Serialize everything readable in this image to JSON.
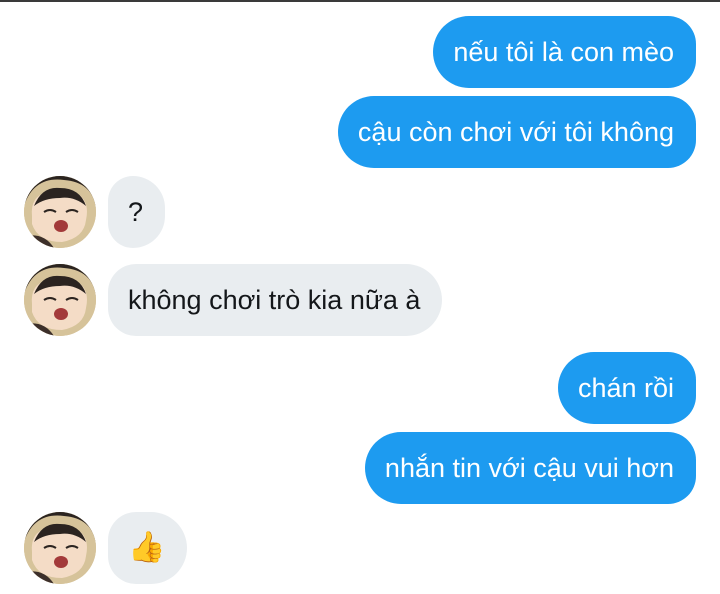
{
  "conversation": {
    "messages": [
      {
        "from": "me",
        "text": "nếu tôi là con mèo"
      },
      {
        "from": "me",
        "text": "cậu còn chơi với tôi không"
      },
      {
        "from": "other",
        "text": "?"
      },
      {
        "from": "other",
        "text": "không chơi trò kia nữa à"
      },
      {
        "from": "me",
        "text": "chán rồi"
      },
      {
        "from": "me",
        "text": "nhắn tin với cậu vui hơn"
      },
      {
        "from": "other",
        "text": "👍"
      }
    ]
  },
  "colors": {
    "outgoing_bubble": "#1d9bf0",
    "incoming_bubble": "#e9edf0",
    "incoming_text": "#14171a"
  },
  "icons": {
    "avatar": "anime-character-avatar",
    "reaction": "thumbs-up-emoji"
  }
}
